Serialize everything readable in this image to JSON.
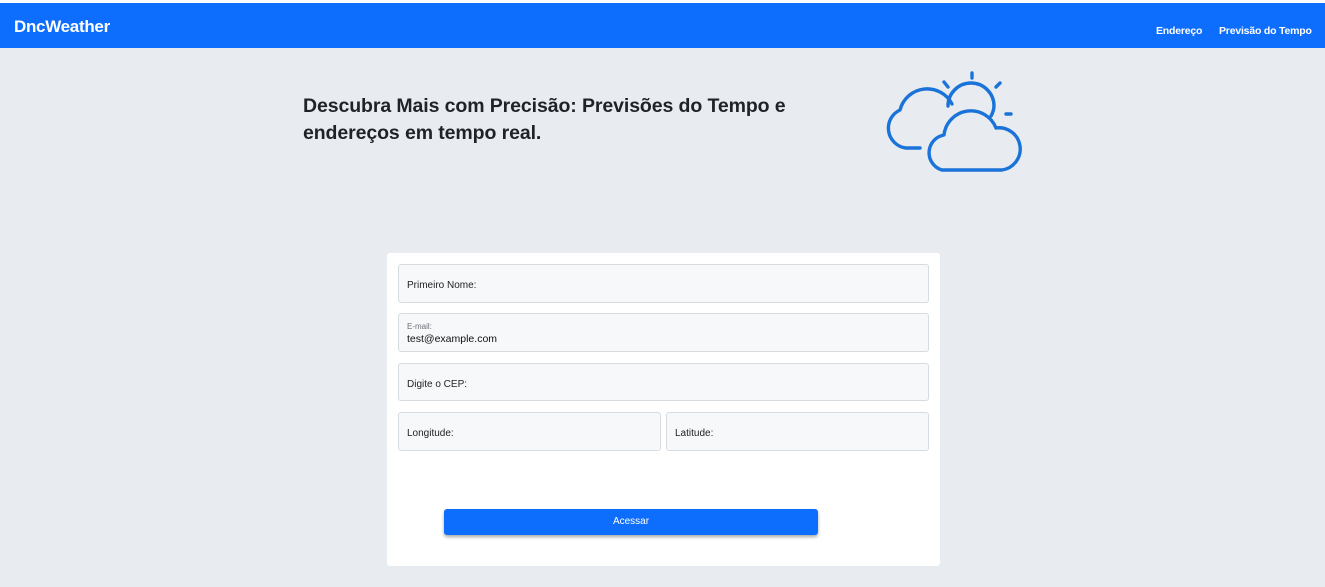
{
  "navbar": {
    "brand": "DncWeather",
    "links": [
      {
        "label": "Endereço"
      },
      {
        "label": "Previsão do Tempo"
      }
    ]
  },
  "hero": {
    "title": "Descubra Mais com Precisão: Previsões do Tempo e endereços em tempo real.",
    "icon": "partly-cloudy-icon"
  },
  "form": {
    "first_name": {
      "label": "Primeiro Nome:",
      "value": ""
    },
    "email": {
      "label": "E-mail:",
      "value": "test@example.com"
    },
    "cep": {
      "label": "Digite o CEP:",
      "value": ""
    },
    "longitude": {
      "label": "Longitude:",
      "value": ""
    },
    "latitude": {
      "label": "Latitude:",
      "value": ""
    },
    "submit_label": "Acessar"
  },
  "colors": {
    "accent": "#0d6efd",
    "background": "#e8ebef",
    "card": "#ffffff",
    "field": "#f6f8fa",
    "icon_stroke": "#1a73d9"
  }
}
